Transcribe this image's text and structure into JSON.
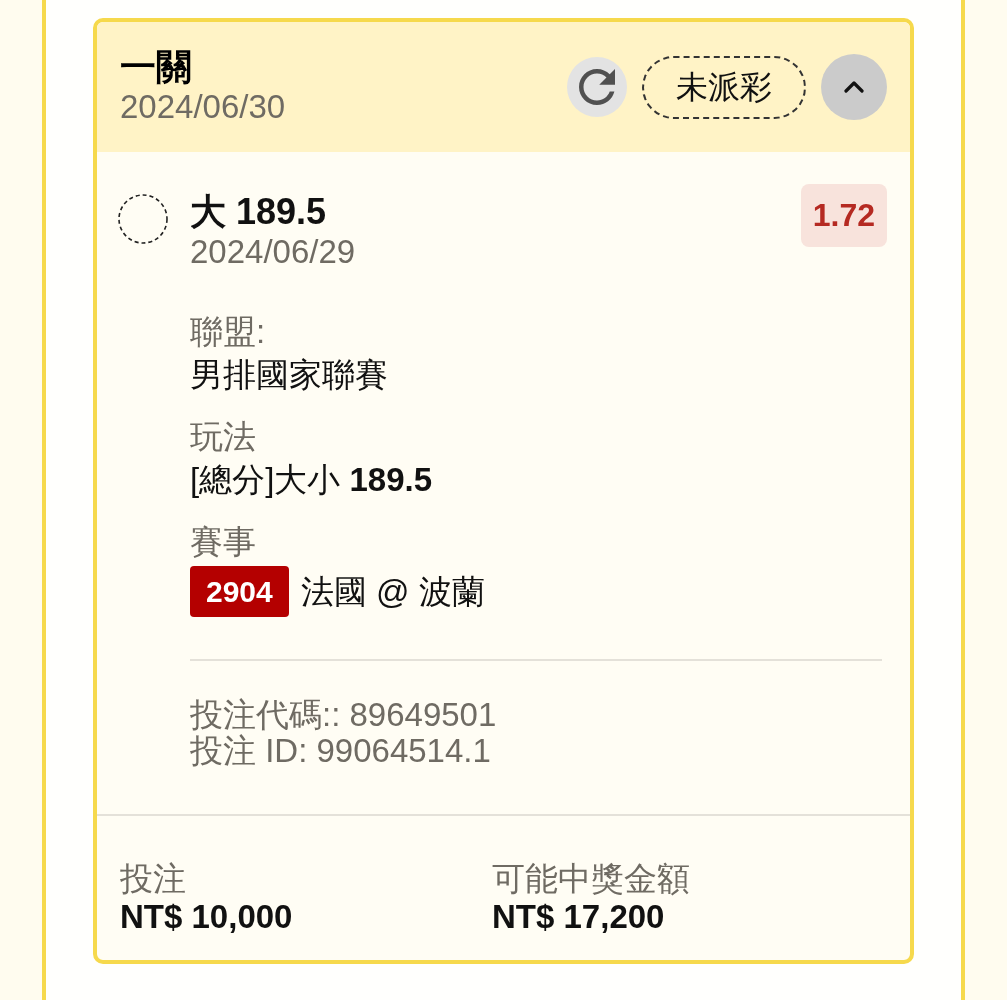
{
  "card": {
    "title": "一關",
    "date": "2024/06/30",
    "status": "未派彩",
    "expanded": true
  },
  "selection": {
    "pick": "大 189.5",
    "date": "2024/06/29",
    "odds": "1.72"
  },
  "details": [
    {
      "kind": "text",
      "label": "聯盟:",
      "value": "男排國家聯賽"
    },
    {
      "kind": "text",
      "label": "玩法",
      "value": "[總分]大小 **189.5**"
    },
    {
      "kind": "match",
      "label": "賽事",
      "match_no": "2904",
      "value": "法國 @ 波蘭"
    }
  ],
  "bet_code": "投注代碼:: 89649501",
  "bet_id": "投注 ID: 99064514.1",
  "footer": [
    {
      "label": "投注",
      "value": "NT$ 10,000"
    },
    {
      "label": "可能中獎金額",
      "value": "NT$ 17,200"
    }
  ]
}
